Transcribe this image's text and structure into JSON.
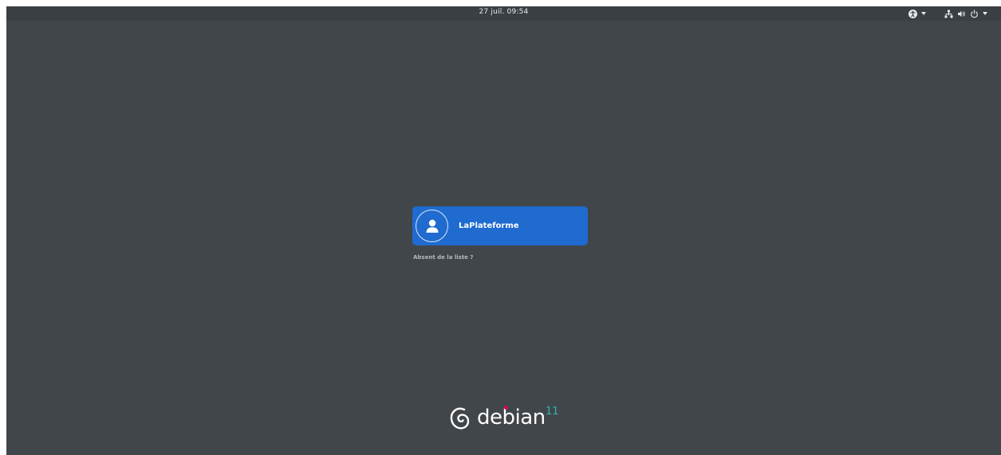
{
  "topbar": {
    "clock": "27 juil.  09:54",
    "accessibility_icon": "accessibility-icon",
    "network_icon": "network-wired-icon",
    "volume_icon": "volume-icon",
    "power_icon": "power-icon",
    "menu_caret_icon": "chevron-down-icon"
  },
  "login": {
    "user_name": "LaPlateforme",
    "avatar_icon": "user-avatar-icon",
    "not_listed": "Absent de la liste ?"
  },
  "branding": {
    "logo_text": "debian",
    "version": "11",
    "swirl_icon": "debian-swirl-icon",
    "accent_color": "#d70751",
    "version_color": "#2ab6ab"
  },
  "colors": {
    "background": "#41464a",
    "user_card": "#1f6bd0"
  }
}
